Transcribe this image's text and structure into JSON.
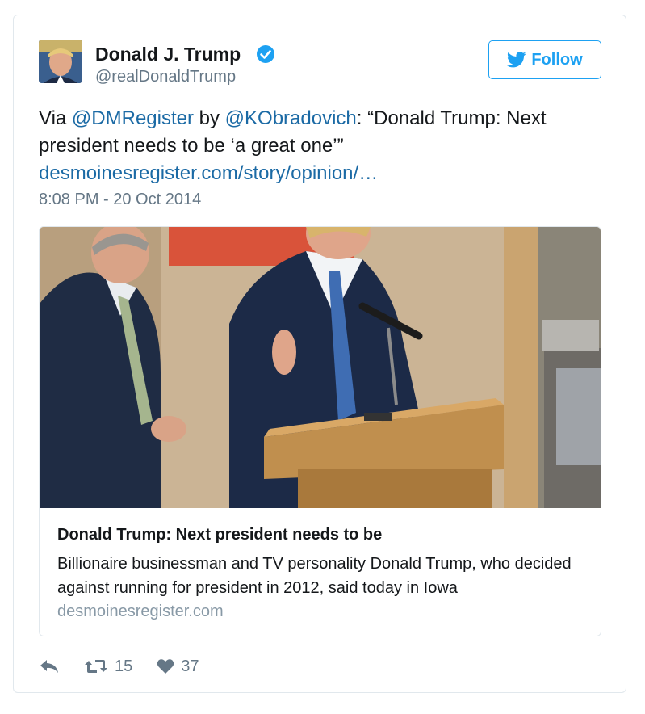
{
  "author": {
    "name": "Donald J. Trump",
    "handle": "@realDonaldTrump",
    "verified": true
  },
  "follow_button": {
    "label": "Follow",
    "icon": "twitter-bird-icon"
  },
  "tweet": {
    "prefix": "Via ",
    "mention1": "@DMRegister",
    "middle": " by ",
    "mention2": "@KObradovich",
    "quote": ": “Donald Trump: Next president needs to be ‘a great one’”",
    "link": "desmoinesregister.com/story/opinion/…",
    "timestamp": "8:08 PM - 20 Oct 2014"
  },
  "card": {
    "title": "Donald Trump: Next president needs to be",
    "description": "Billionaire businessman and TV personality Donald Trump, who decided against running for president in 2012, said today in Iowa",
    "domain": "desmoinesregister.com"
  },
  "actions": {
    "reply_icon": "reply-icon",
    "retweet_icon": "retweet-icon",
    "retweet_count": "15",
    "like_icon": "heart-icon",
    "like_count": "37"
  },
  "colors": {
    "accent": "#1da1f2",
    "link": "#1b6aa5",
    "secondary_text": "#657786"
  }
}
